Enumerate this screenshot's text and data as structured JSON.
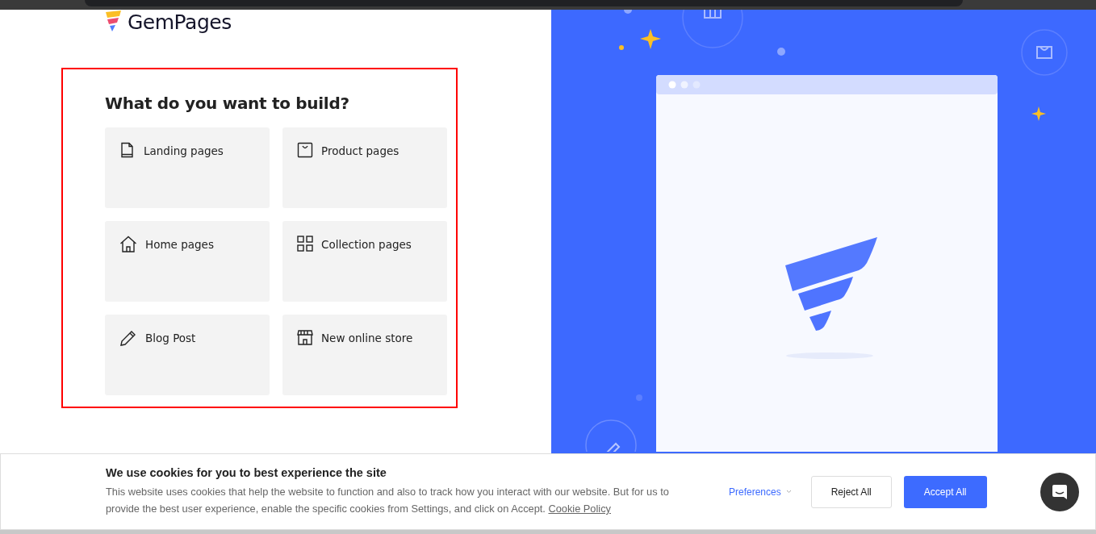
{
  "brand": {
    "name": "GemPages"
  },
  "builder": {
    "heading": "What do you want to build?",
    "options": [
      {
        "label": "Landing pages",
        "kind": "document"
      },
      {
        "label": "Product pages",
        "kind": "bag"
      },
      {
        "label": "Home pages",
        "kind": "house"
      },
      {
        "label": "Collection pages",
        "kind": "grid"
      },
      {
        "label": "Blog Post",
        "kind": "pencil"
      },
      {
        "label": "New online store",
        "kind": "store"
      }
    ]
  },
  "cookie_banner": {
    "title": "We use cookies for you to best experience the site",
    "text": "This website uses cookies that help the website to function and also to track how you interact with our website. But for us to provide the best user experience, enable the specific cookies from Settings, and click on Accept.",
    "link": "Cookie Policy",
    "preferences": "Preferences",
    "reject": "Reject All",
    "accept": "Accept All"
  }
}
